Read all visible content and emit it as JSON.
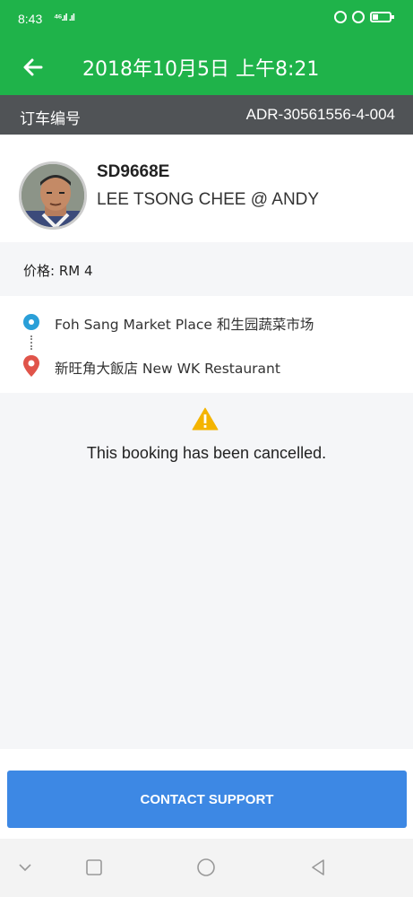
{
  "status_bar": {
    "time": "8:43",
    "signal": "⁴⁶.ıl .ıl"
  },
  "app_bar": {
    "title": "2018年10月5日 上午8:21",
    "back_icon": "arrow-left-icon"
  },
  "booking": {
    "ref_label": "订车编号",
    "ref_value": "ADR-30561556-4-004"
  },
  "driver": {
    "plate": "SD9668E",
    "name": "LEE TSONG CHEE @ ANDY"
  },
  "price": {
    "label": "价格: RM 4"
  },
  "route": {
    "pickup": "Foh Sang Market Place 和生园蔬菜市场",
    "dropoff": "新旺角大飯店 New WK Restaurant"
  },
  "status": {
    "message": "This booking has been cancelled.",
    "icon": "warning-icon"
  },
  "actions": {
    "contact_support": "CONTACT SUPPORT"
  },
  "colors": {
    "primary": "#1fb34a",
    "ref_bar": "#505356",
    "button": "#3d88e4",
    "pickup": "#2a9fd8",
    "dropoff": "#e0544a",
    "warning": "#f4b400"
  }
}
